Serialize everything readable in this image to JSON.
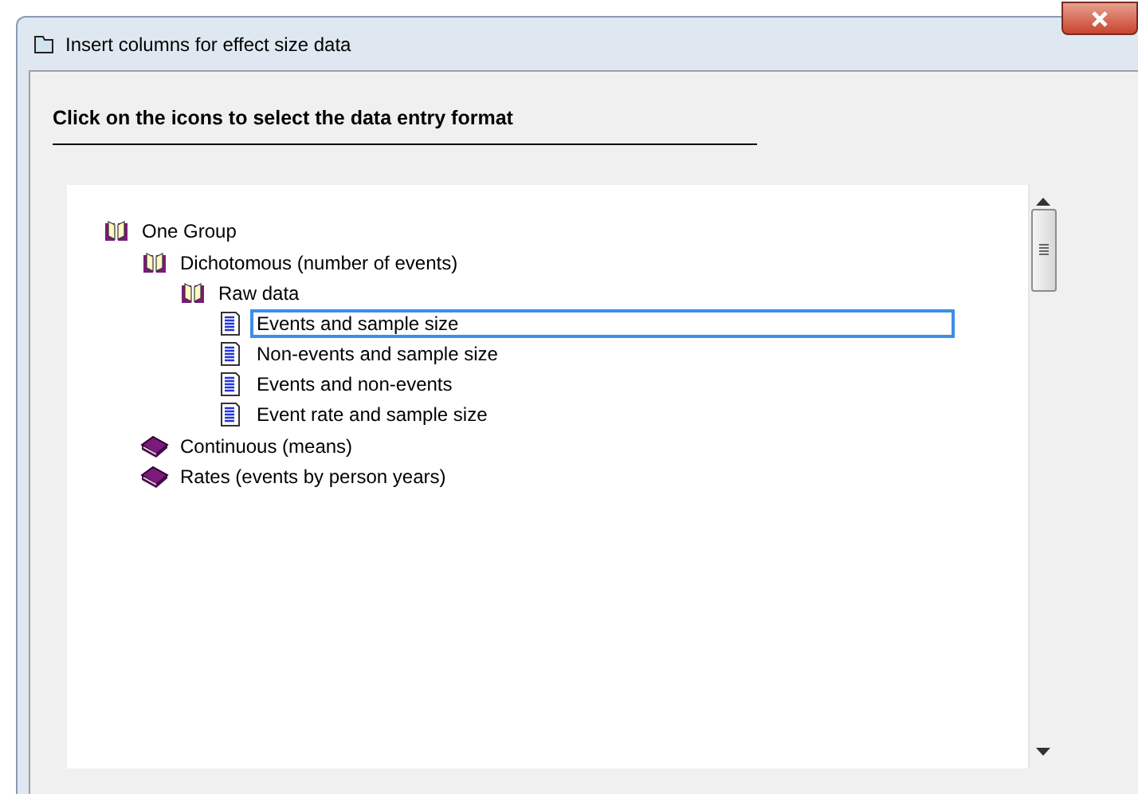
{
  "window": {
    "title": "Insert columns for effect size data"
  },
  "heading": "Click on the icons to select the data entry format",
  "tree": [
    {
      "label": "One Group",
      "kind": "folder",
      "expanded": true,
      "selected": false,
      "children": [
        {
          "label": "Dichotomous (number of events)",
          "kind": "folder",
          "expanded": true,
          "selected": false,
          "children": [
            {
              "label": "Raw data",
              "kind": "folder",
              "expanded": true,
              "selected": false,
              "children": [
                {
                  "label": "Events and sample size",
                  "kind": "document",
                  "selected": true
                },
                {
                  "label": "Non-events and sample size",
                  "kind": "document",
                  "selected": false
                },
                {
                  "label": "Events and non-events",
                  "kind": "document",
                  "selected": false
                },
                {
                  "label": "Event rate and sample size",
                  "kind": "document",
                  "selected": false
                }
              ]
            }
          ]
        },
        {
          "label": "Continuous (means)",
          "kind": "folder",
          "expanded": false,
          "selected": false
        },
        {
          "label": "Rates (events by person years)",
          "kind": "folder",
          "expanded": false,
          "selected": false
        }
      ]
    }
  ]
}
